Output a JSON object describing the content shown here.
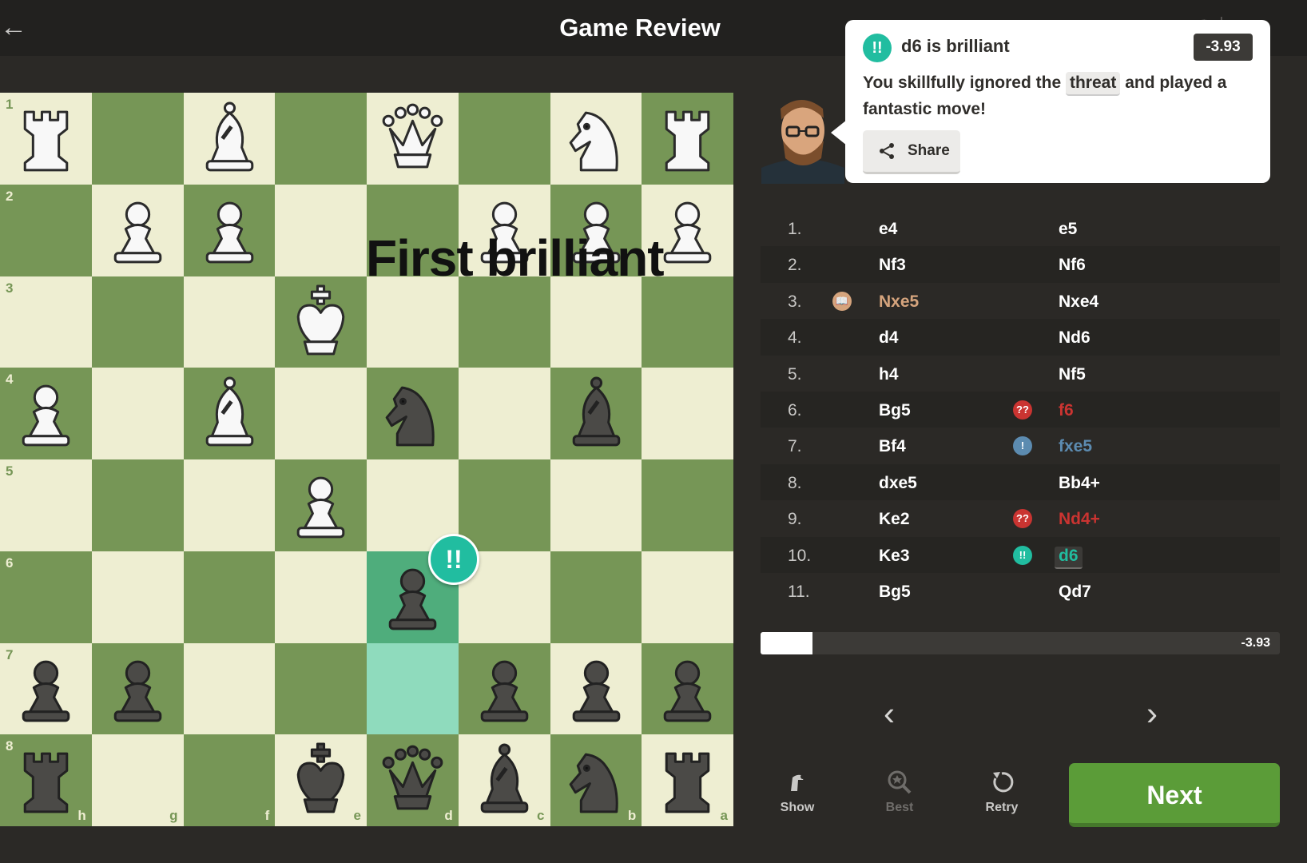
{
  "header": {
    "back_icon": "back-arrow-icon",
    "title": "Game Review"
  },
  "board": {
    "overlay_text": "First brilliant",
    "brilliant_badge": "!!",
    "colors": {
      "light": "#eeeed2",
      "dark": "#769656",
      "destination_highlight": "#4fad7c",
      "origin_highlight": "#8fdbbd",
      "brilliant": "#21bda0"
    },
    "ranks": [
      "1",
      "2",
      "3",
      "4",
      "5",
      "6",
      "7",
      "8"
    ],
    "files": [
      "h",
      "g",
      "f",
      "e",
      "d",
      "c",
      "b",
      "a"
    ],
    "pieces": [
      {
        "square": "h1",
        "piece": "white-rook"
      },
      {
        "square": "f1",
        "piece": "white-bishop"
      },
      {
        "square": "d1",
        "piece": "white-queen"
      },
      {
        "square": "b1",
        "piece": "white-knight"
      },
      {
        "square": "a1",
        "piece": "white-rook"
      },
      {
        "square": "g2",
        "piece": "white-pawn"
      },
      {
        "square": "f2",
        "piece": "white-pawn"
      },
      {
        "square": "c2",
        "piece": "white-pawn"
      },
      {
        "square": "b2",
        "piece": "white-pawn"
      },
      {
        "square": "a2",
        "piece": "white-pawn"
      },
      {
        "square": "e3",
        "piece": "white-king"
      },
      {
        "square": "h4",
        "piece": "white-pawn"
      },
      {
        "square": "f4",
        "piece": "white-bishop"
      },
      {
        "square": "d4",
        "piece": "black-knight"
      },
      {
        "square": "b4",
        "piece": "black-bishop"
      },
      {
        "square": "e5",
        "piece": "white-pawn"
      },
      {
        "square": "d6",
        "piece": "black-pawn"
      },
      {
        "square": "h7",
        "piece": "black-pawn"
      },
      {
        "square": "g7",
        "piece": "black-pawn"
      },
      {
        "square": "c7",
        "piece": "black-pawn"
      },
      {
        "square": "b7",
        "piece": "black-pawn"
      },
      {
        "square": "a7",
        "piece": "black-pawn"
      },
      {
        "square": "h8",
        "piece": "black-rook"
      },
      {
        "square": "e8",
        "piece": "black-king"
      },
      {
        "square": "d8",
        "piece": "black-queen"
      },
      {
        "square": "c8",
        "piece": "black-bishop"
      },
      {
        "square": "b8",
        "piece": "black-knight"
      },
      {
        "square": "a8",
        "piece": "black-rook"
      }
    ],
    "highlights": [
      "d6",
      "d7"
    ]
  },
  "coach": {
    "avatar": "coach-avatar",
    "icon": "!!",
    "title": "d6 is brilliant",
    "eval": "-3.93",
    "message_before": "You skillfully ignored the",
    "message_chip": "threat",
    "message_after": "and played a fantastic move!",
    "share_label": "Share",
    "share_icon": "share-icon"
  },
  "moves": [
    {
      "number": "1.",
      "white": "e4",
      "black": "e5"
    },
    {
      "number": "2.",
      "white": "Nf3",
      "black": "Nf6"
    },
    {
      "number": "3.",
      "white": "Nxe5",
      "white_icon": "book-icon",
      "white_class": "book",
      "black": "Nxe4"
    },
    {
      "number": "4.",
      "white": "d4",
      "black": "Nd6"
    },
    {
      "number": "5.",
      "white": "h4",
      "black": "Nf5"
    },
    {
      "number": "6.",
      "white": "Bg5",
      "black": "f6",
      "black_icon": "??",
      "black_class": "blunder"
    },
    {
      "number": "7.",
      "white": "Bf4",
      "black": "fxe5",
      "black_icon": "!",
      "black_class": "inaccuracy"
    },
    {
      "number": "8.",
      "white": "dxe5",
      "black": "Bb4+"
    },
    {
      "number": "9.",
      "white": "Ke2",
      "black": "Nd4+",
      "black_icon": "??",
      "black_class": "blunder"
    },
    {
      "number": "10.",
      "white": "Ke3",
      "black": "d6",
      "black_icon": "!!",
      "black_class": "brilliant-small",
      "selected": true
    },
    {
      "number": "11.",
      "white": "Bg5",
      "black": "Qd7"
    }
  ],
  "evaluation": {
    "text": "-3.93",
    "white_fraction": 0.1
  },
  "navigation": {
    "previous_icon": "chevron-left-icon",
    "next_icon": "chevron-right-icon"
  },
  "toolbar": {
    "show_label": "Show",
    "show_icon": "show-hint-icon",
    "best_label": "Best",
    "best_icon": "best-move-icon",
    "retry_label": "Retry",
    "retry_icon": "retry-icon",
    "next_label": "Next"
  }
}
